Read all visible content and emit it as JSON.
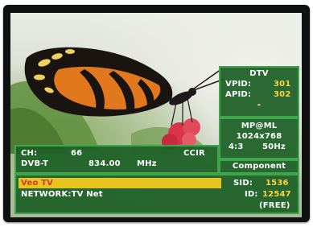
{
  "dtv_panel": {
    "title": "DTV",
    "vpid_label": "VPID:",
    "vpid_value": "301",
    "apid_label": "APID:",
    "apid_value": "302",
    "extra": "-"
  },
  "format_panel": {
    "profile": "MP@ML",
    "resolution": "1024x768",
    "aspect": "4:3",
    "refresh": "50Hz"
  },
  "output_panel": {
    "label": "Component"
  },
  "channel_panel": {
    "ch_label": "CH:",
    "ch_value": "66",
    "standard": "CCIR",
    "mode": "DVB-T",
    "frequency": "834.00",
    "unit": "MHz"
  },
  "service_panel": {
    "service_name": "Veo TV",
    "network": "NETWORK:TV Net",
    "sid_label": "SID:",
    "sid_value": "1536",
    "id_label": "ID:",
    "id_value": "12547",
    "access": "(FREE)"
  },
  "colors": {
    "panel_bg": "#1c6026",
    "panel_border": "#3fa64b",
    "highlight_bar": "#e8c51e",
    "service_text": "#d23a2a",
    "value_text": "#ffd23a"
  }
}
